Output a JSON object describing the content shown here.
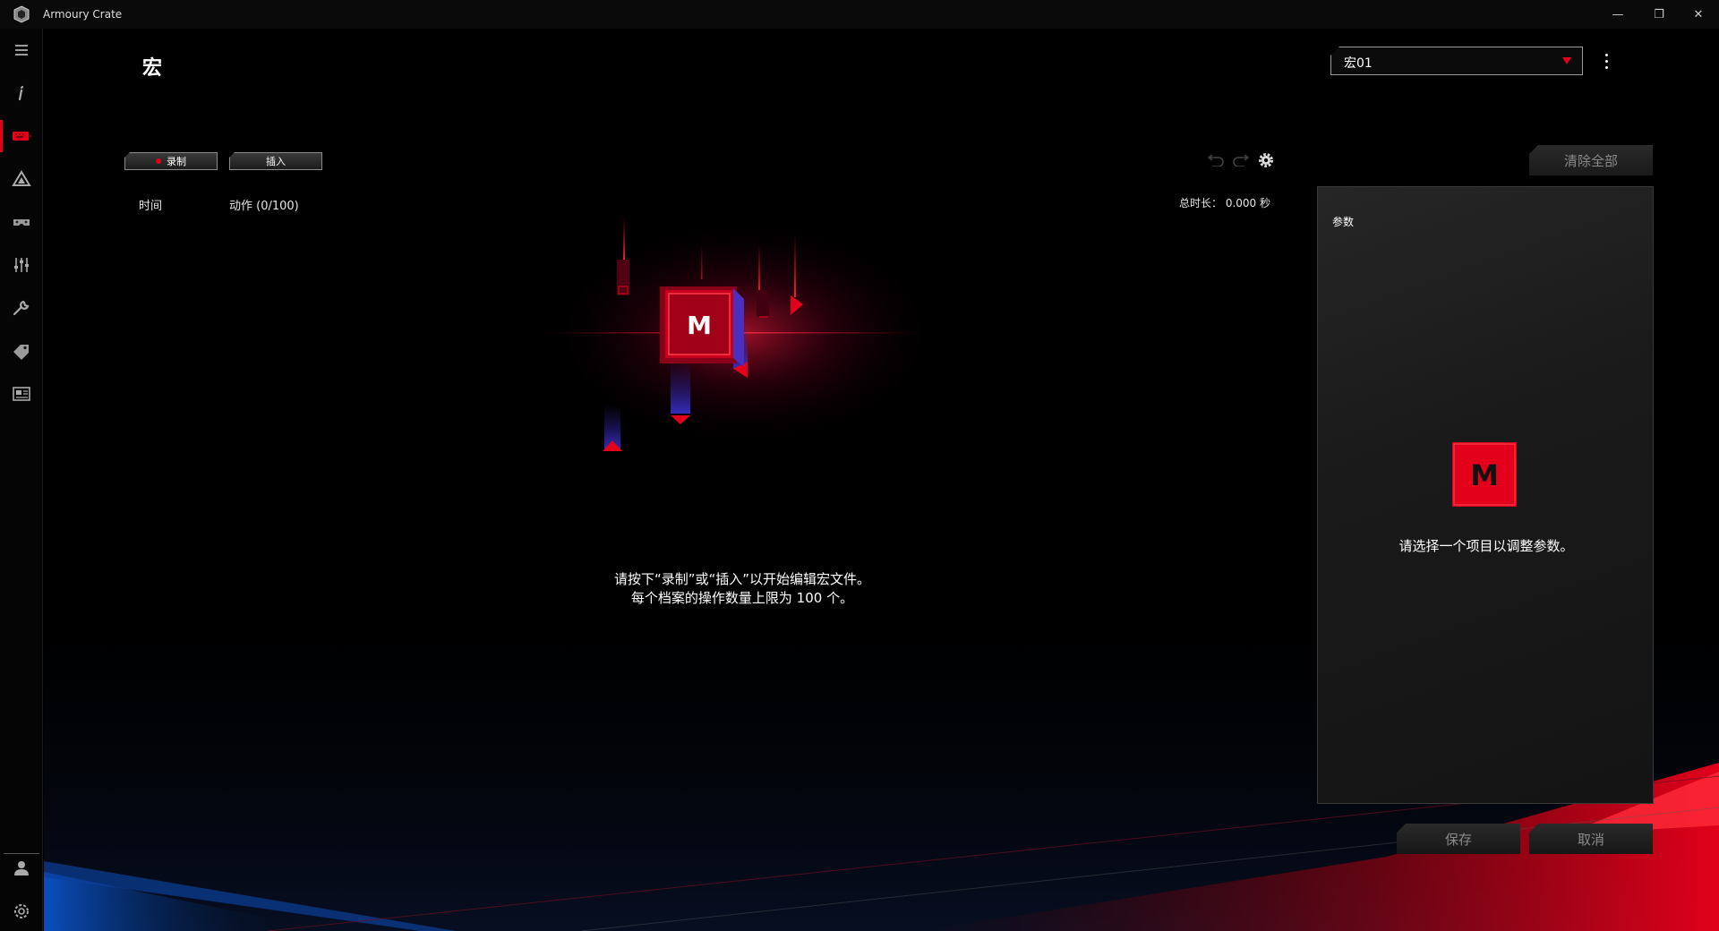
{
  "window": {
    "title": "Armoury Crate",
    "minimize_glyph": "—",
    "restore_glyph": "❐",
    "close_glyph": "✕"
  },
  "sidebar": {
    "items": [
      {
        "name": "menu",
        "icon": "hamburger-menu-icon"
      },
      {
        "name": "info",
        "icon": "info-icon"
      },
      {
        "name": "device",
        "icon": "keyboard-device-icon",
        "active": true
      },
      {
        "name": "aura",
        "icon": "aura-triangle-icon"
      },
      {
        "name": "gamevisual",
        "icon": "gamepad-icon"
      },
      {
        "name": "scenario",
        "icon": "sliders-icon"
      },
      {
        "name": "tools",
        "icon": "wrench-icon"
      },
      {
        "name": "deals",
        "icon": "tag-icon"
      },
      {
        "name": "news",
        "icon": "news-icon"
      },
      {
        "name": "user",
        "icon": "user-icon"
      },
      {
        "name": "settings",
        "icon": "gear-icon"
      }
    ]
  },
  "header": {
    "title": "宏",
    "profile_value": "宏01"
  },
  "toolbar": {
    "record_label": "录制",
    "insert_label": "插入",
    "clear_all_label": "清除全部"
  },
  "list": {
    "col_time": "时间",
    "col_action": "动作 (0/100)",
    "total_duration": "总时长： 0.000 秒"
  },
  "empty_state": {
    "line1": "请按下“录制”或“插入”以开始编辑宏文件。",
    "line2": "每个档案的操作数量上限为 100 个。",
    "key_letter": "M"
  },
  "params": {
    "title": "参数",
    "key_letter": "M",
    "hint": "请选择一个项目以调整参数。"
  },
  "footer": {
    "save_label": "保存",
    "cancel_label": "取消"
  },
  "colors": {
    "accent": "#e2001a",
    "blue_accent": "#1565d8",
    "panel_bg": "#1e1e1e"
  }
}
